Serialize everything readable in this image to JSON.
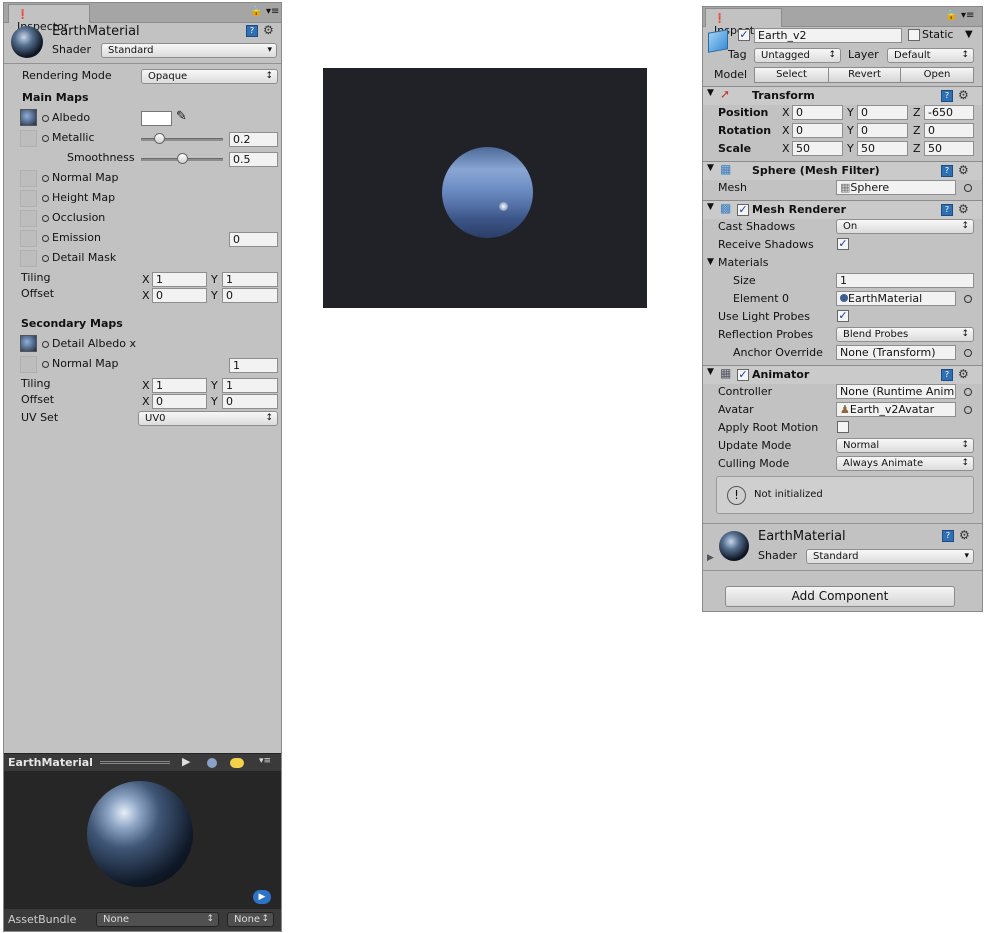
{
  "left": {
    "tab": "Inspector",
    "material_name": "EarthMaterial",
    "shader_label": "Shader",
    "shader_value": "Standard",
    "rendering_mode_label": "Rendering Mode",
    "rendering_mode_value": "Opaque",
    "main_maps": "Main Maps",
    "albedo": "Albedo",
    "metallic": "Metallic",
    "metallic_value": "0.2",
    "metallic_slider": 0.2,
    "smoothness": "Smoothness",
    "smoothness_value": "0.5",
    "smoothness_slider": 0.5,
    "normal_map": "Normal Map",
    "height_map": "Height Map",
    "occlusion": "Occlusion",
    "emission": "Emission",
    "emission_value": "0",
    "detail_mask": "Detail Mask",
    "tiling": "Tiling",
    "offset": "Offset",
    "x": "X",
    "y": "Y",
    "tiling_x": "1",
    "tiling_y": "1",
    "offset_x": "0",
    "offset_y": "0",
    "secondary_maps": "Secondary Maps",
    "detail_albedo": "Detail Albedo x",
    "normal_map2": "Normal Map",
    "normal_map2_value": "1",
    "tiling2_x": "1",
    "tiling2_y": "1",
    "offset2_x": "0",
    "offset2_y": "0",
    "uv_set_label": "UV Set",
    "uv_set_value": "UV0",
    "preview_title": "EarthMaterial",
    "assetbundle_label": "AssetBundle",
    "assetbundle_value": "None",
    "assetbundle_variant": "None"
  },
  "right": {
    "tab": "Inspector",
    "object_name": "Earth_v2",
    "static_label": "Static",
    "tag_label": "Tag",
    "tag_value": "Untagged",
    "layer_label": "Layer",
    "layer_value": "Default",
    "model_label": "Model",
    "select": "Select",
    "revert": "Revert",
    "open": "Open",
    "transform": {
      "title": "Transform",
      "position": "Position",
      "rotation": "Rotation",
      "scale": "Scale",
      "x": "X",
      "y": "Y",
      "z": "Z",
      "pos": [
        "0",
        "0",
        "-650"
      ],
      "rot": [
        "0",
        "0",
        "0"
      ],
      "scl": [
        "50",
        "50",
        "50"
      ]
    },
    "mesh_filter": {
      "title": "Sphere (Mesh Filter)",
      "mesh_label": "Mesh",
      "mesh_value": "Sphere"
    },
    "mesh_renderer": {
      "title": "Mesh Renderer",
      "cast_shadows": "Cast Shadows",
      "cast_shadows_value": "On",
      "receive_shadows": "Receive Shadows",
      "materials": "Materials",
      "size": "Size",
      "size_value": "1",
      "element0": "Element 0",
      "element0_value": "EarthMaterial",
      "use_light_probes": "Use Light Probes",
      "reflection_probes": "Reflection Probes",
      "reflection_probes_value": "Blend Probes",
      "anchor_override": "Anchor Override",
      "anchor_override_value": "None (Transform)"
    },
    "animator": {
      "title": "Animator",
      "controller": "Controller",
      "controller_value": "None (Runtime Anim",
      "avatar": "Avatar",
      "avatar_value": "Earth_v2Avatar",
      "apply_root_motion": "Apply Root Motion",
      "update_mode": "Update Mode",
      "update_mode_value": "Normal",
      "culling_mode": "Culling Mode",
      "culling_mode_value": "Always Animate",
      "info": "Not initialized"
    },
    "material": {
      "name": "EarthMaterial",
      "shader_label": "Shader",
      "shader_value": "Standard"
    },
    "add_component": "Add Component"
  },
  "colors": {
    "panel_bg": "#c2c2c2",
    "scene_bg": "#202227",
    "preview_bg": "#262626",
    "checkbox_blue": "#103f9e"
  }
}
